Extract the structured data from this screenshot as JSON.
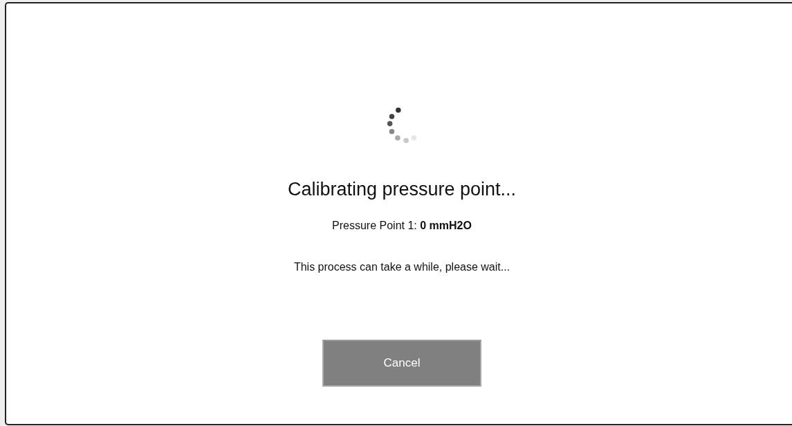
{
  "dialog": {
    "title": "Calibrating pressure point...",
    "detail": "Pressure Point 1: **0 mmH2O**",
    "message": "This process can take a while, please wait...",
    "buttons": [
      {
        "label": "Cancel"
      }
    ]
  }
}
